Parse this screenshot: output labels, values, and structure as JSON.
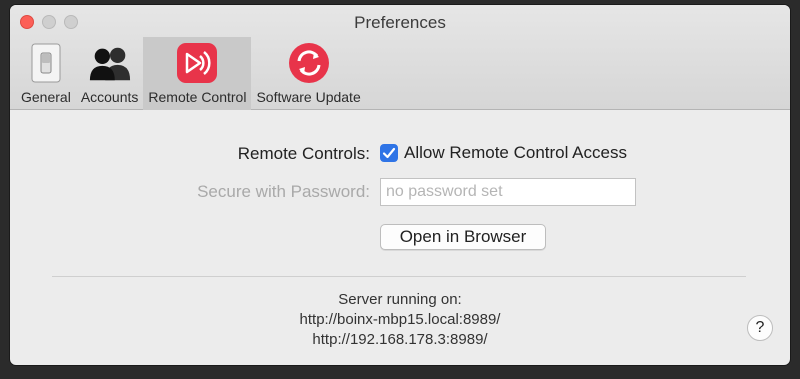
{
  "window": {
    "title": "Preferences",
    "traffic_lights": [
      "close",
      "minimize",
      "zoom"
    ]
  },
  "toolbar": {
    "items": [
      {
        "label": "General",
        "icon": "switch-icon",
        "active": false
      },
      {
        "label": "Accounts",
        "icon": "users-icon",
        "active": false
      },
      {
        "label": "Remote Control",
        "icon": "remote-control-icon",
        "active": true
      },
      {
        "label": "Software Update",
        "icon": "software-update-icon",
        "active": false
      }
    ]
  },
  "remote": {
    "controls_label": "Remote Controls:",
    "allow_label": "Allow Remote Control Access",
    "allow_checked": true,
    "password_label": "Secure with Password:",
    "password_placeholder": "no password set",
    "open_browser_label": "Open in Browser"
  },
  "server": {
    "heading": "Server running on:",
    "urls": [
      "http://boinx-mbp15.local:8989/",
      "http://192.168.178.3:8989/"
    ]
  },
  "help": {
    "label": "?"
  },
  "colors": {
    "accent": "#2f74e6",
    "close_button": "#fc5f57",
    "brand_red": "#e8344a"
  }
}
